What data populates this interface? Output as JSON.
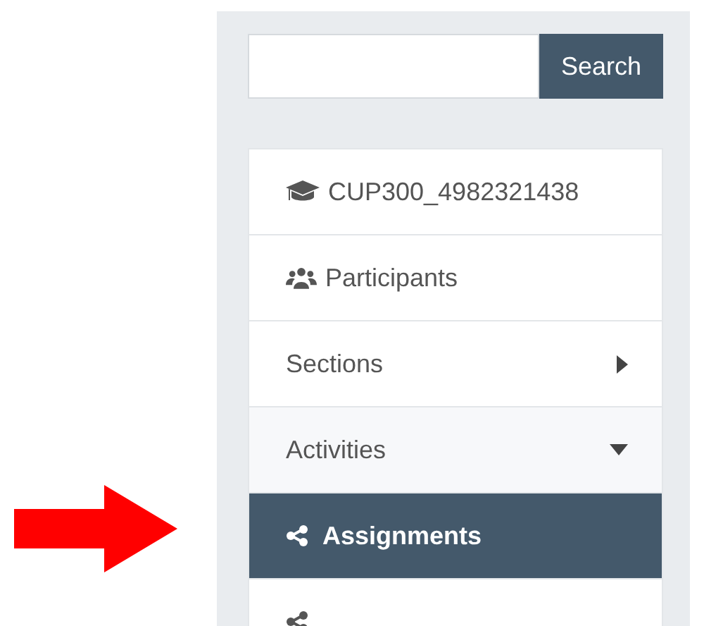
{
  "search": {
    "button": "Search"
  },
  "menu": {
    "items": [
      {
        "kind": "course",
        "label": "CUP300_4982321438"
      },
      {
        "kind": "participants",
        "label": "Participants"
      },
      {
        "kind": "group",
        "label": "Sections",
        "expanded": false
      },
      {
        "kind": "group",
        "label": "Activities",
        "expanded": true,
        "children": [
          {
            "kind": "activity",
            "label": "Assignments",
            "selected": true
          },
          {
            "kind": "activity",
            "selected": false
          }
        ]
      }
    ]
  }
}
